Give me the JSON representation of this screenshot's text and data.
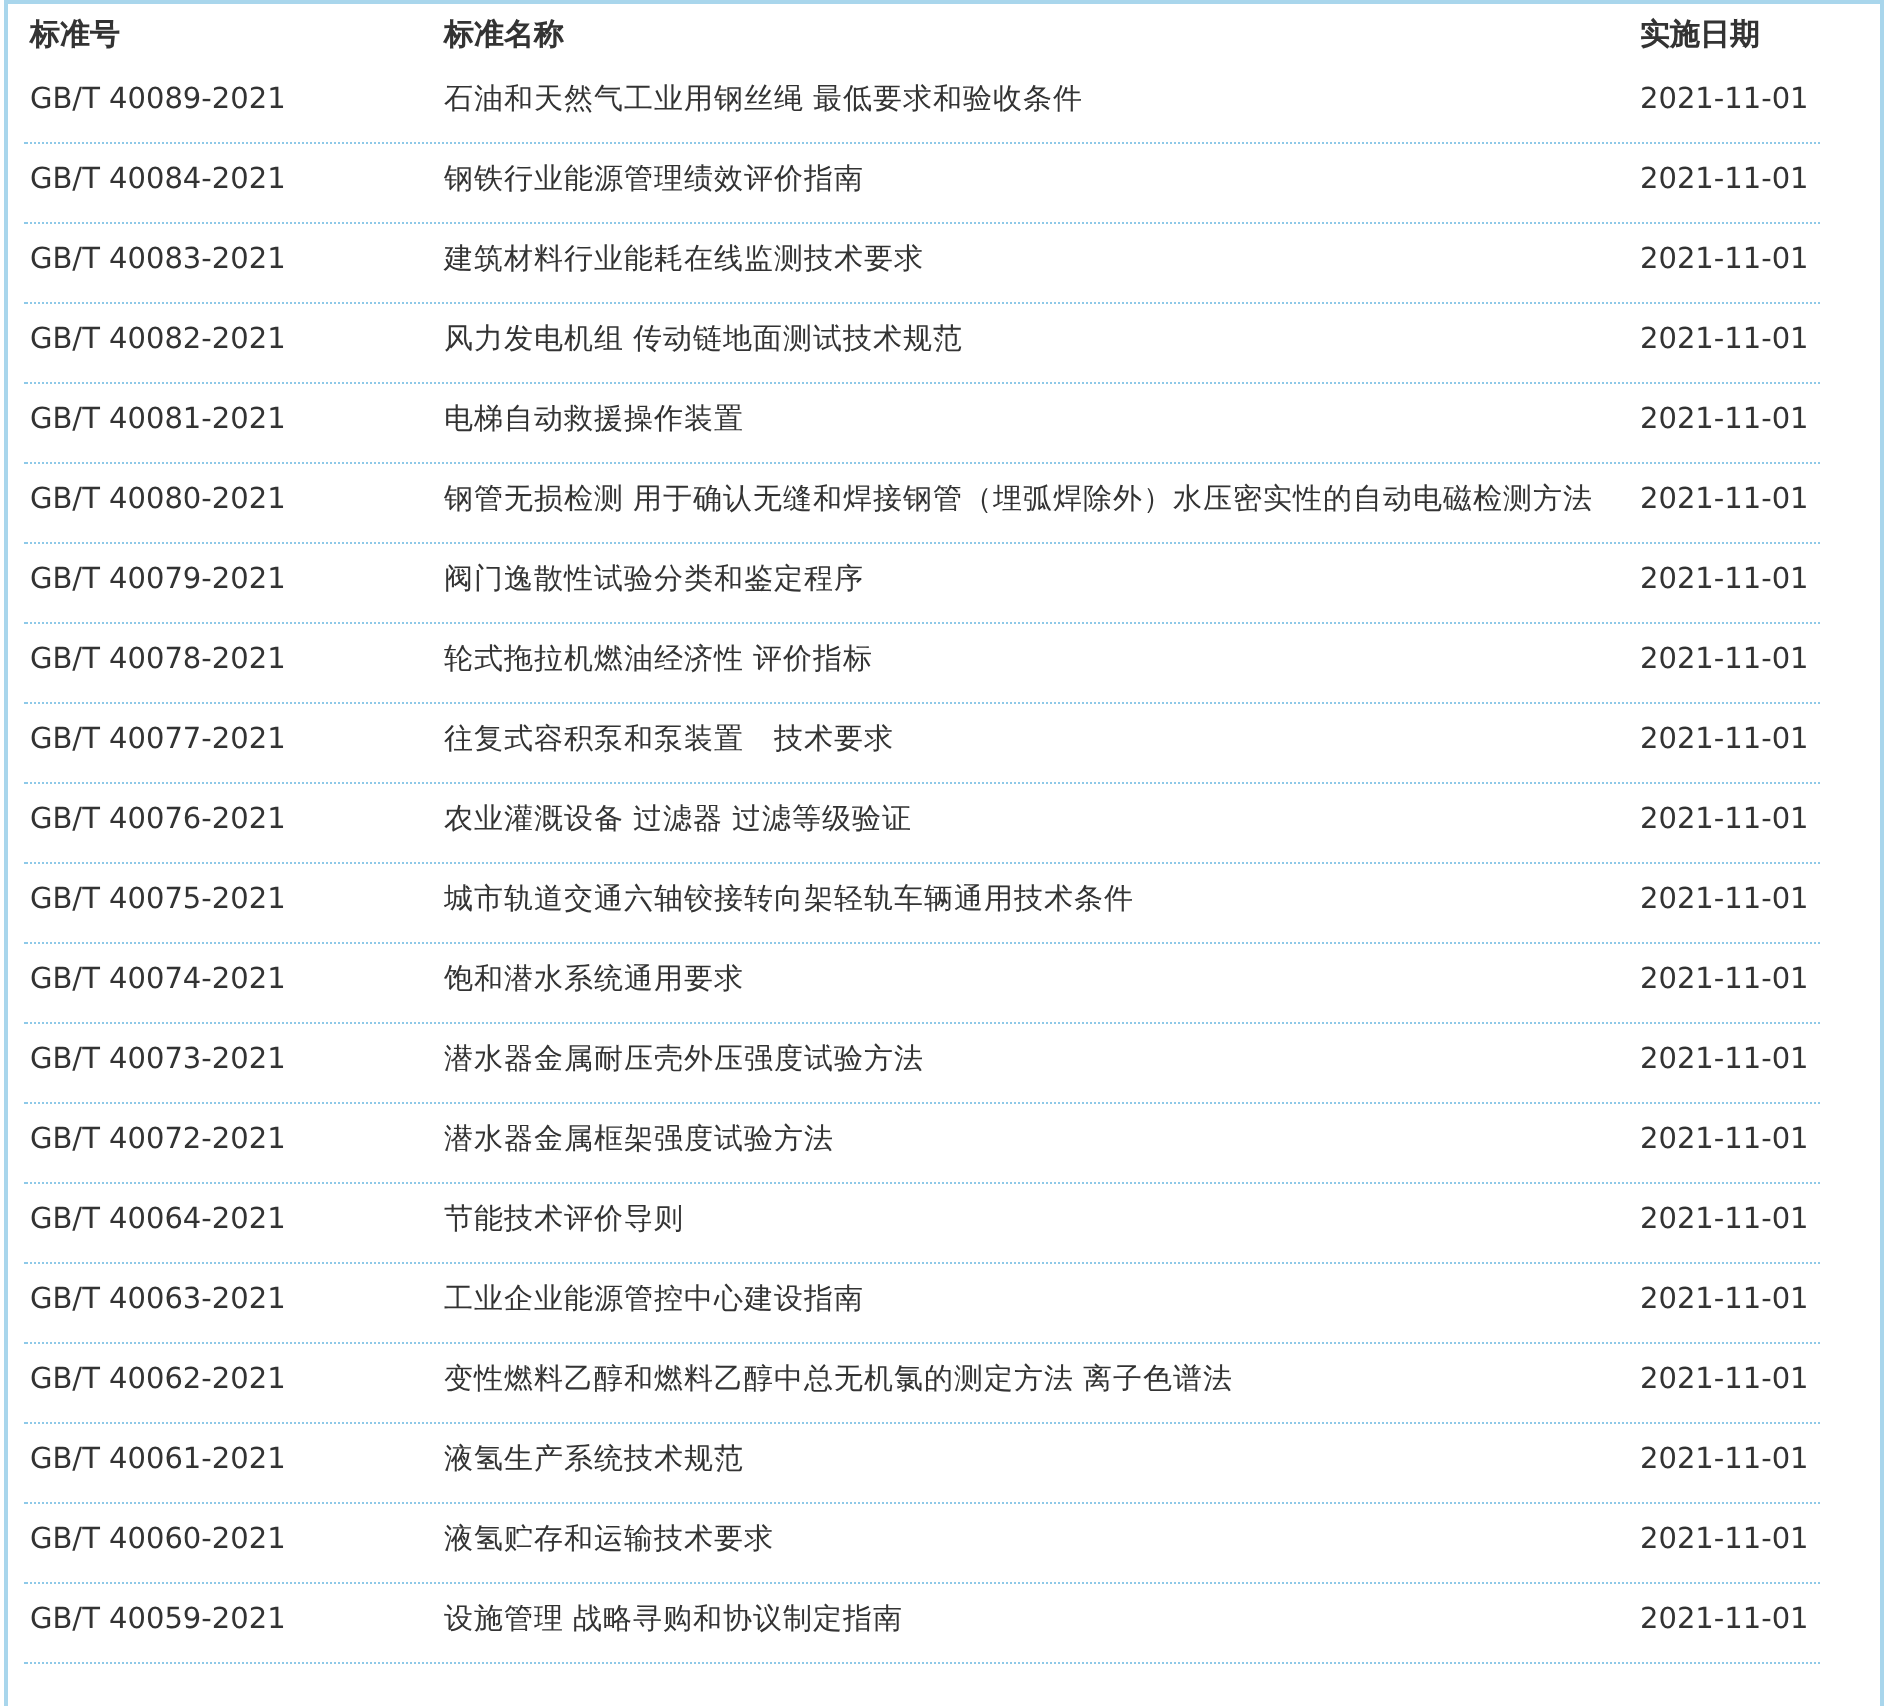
{
  "table": {
    "columns": [
      "标准号",
      "标准名称",
      "实施日期"
    ],
    "rows": [
      {
        "code": "GB/T 40089-2021",
        "name": "石油和天然气工业用钢丝绳 最低要求和验收条件",
        "date": "2021-11-01"
      },
      {
        "code": "GB/T 40084-2021",
        "name": "钢铁行业能源管理绩效评价指南",
        "date": "2021-11-01"
      },
      {
        "code": "GB/T 40083-2021",
        "name": "建筑材料行业能耗在线监测技术要求",
        "date": "2021-11-01"
      },
      {
        "code": "GB/T 40082-2021",
        "name": "风力发电机组 传动链地面测试技术规范",
        "date": "2021-11-01"
      },
      {
        "code": "GB/T 40081-2021",
        "name": "电梯自动救援操作装置",
        "date": "2021-11-01"
      },
      {
        "code": "GB/T 40080-2021",
        "name": "钢管无损检测 用于确认无缝和焊接钢管（埋弧焊除外）水压密实性的自动电磁检测方法",
        "date": "2021-11-01"
      },
      {
        "code": "GB/T 40079-2021",
        "name": "阀门逸散性试验分类和鉴定程序",
        "date": "2021-11-01"
      },
      {
        "code": "GB/T 40078-2021",
        "name": "轮式拖拉机燃油经济性 评价指标",
        "date": "2021-11-01"
      },
      {
        "code": "GB/T 40077-2021",
        "name": "往复式容积泵和泵装置　技术要求",
        "date": "2021-11-01"
      },
      {
        "code": "GB/T 40076-2021",
        "name": "农业灌溉设备 过滤器 过滤等级验证",
        "date": "2021-11-01"
      },
      {
        "code": "GB/T 40075-2021",
        "name": "城市轨道交通六轴铰接转向架轻轨车辆通用技术条件",
        "date": "2021-11-01"
      },
      {
        "code": "GB/T 40074-2021",
        "name": "饱和潜水系统通用要求",
        "date": "2021-11-01"
      },
      {
        "code": "GB/T 40073-2021",
        "name": "潜水器金属耐压壳外压强度试验方法",
        "date": "2021-11-01"
      },
      {
        "code": "GB/T 40072-2021",
        "name": "潜水器金属框架强度试验方法",
        "date": "2021-11-01"
      },
      {
        "code": "GB/T 40064-2021",
        "name": "节能技术评价导则",
        "date": "2021-11-01"
      },
      {
        "code": "GB/T 40063-2021",
        "name": "工业企业能源管控中心建设指南",
        "date": "2021-11-01"
      },
      {
        "code": "GB/T 40062-2021",
        "name": "变性燃料乙醇和燃料乙醇中总无机氯的测定方法 离子色谱法",
        "date": "2021-11-01"
      },
      {
        "code": "GB/T 40061-2021",
        "name": "液氢生产系统技术规范",
        "date": "2021-11-01"
      },
      {
        "code": "GB/T 40060-2021",
        "name": "液氢贮存和运输技术要求",
        "date": "2021-11-01"
      },
      {
        "code": "GB/T 40059-2021",
        "name": "设施管理 战略寻购和协议制定指南",
        "date": "2021-11-01"
      }
    ]
  }
}
